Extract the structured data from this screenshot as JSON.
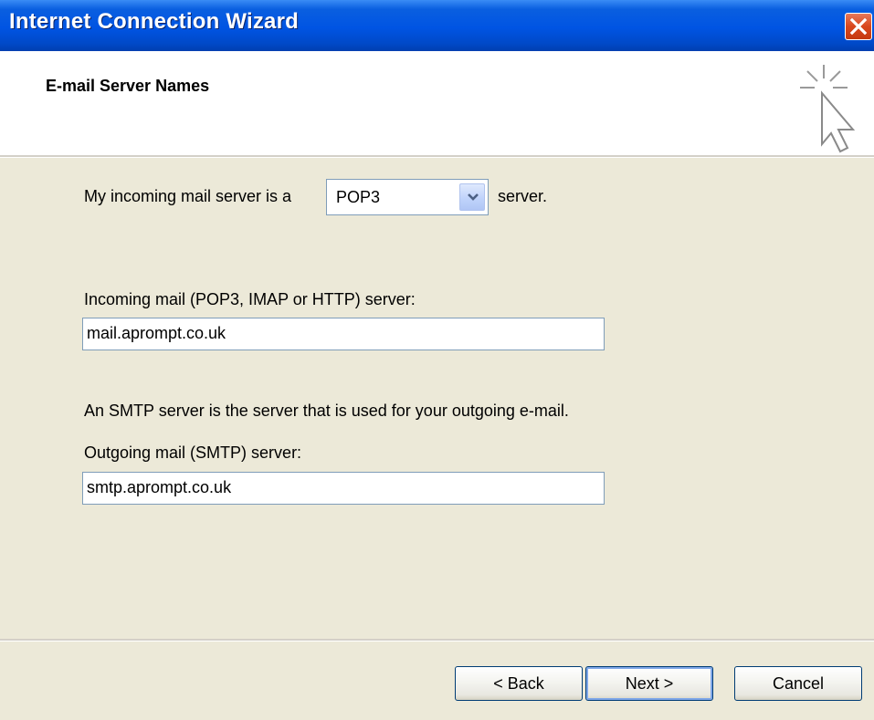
{
  "window": {
    "title": "Internet Connection Wizard",
    "close_icon": "close-icon"
  },
  "header": {
    "title": "E-mail Server Names",
    "icon": "wizard-cursor-icon"
  },
  "form": {
    "server_type_prefix": "My incoming mail server is a",
    "server_type_value": "POP3",
    "server_type_suffix": "server.",
    "incoming_label": "Incoming mail (POP3, IMAP or HTTP) server:",
    "incoming_value": "mail.aprompt.co.uk",
    "smtp_description": "An SMTP server is the server that is used for your outgoing e-mail.",
    "outgoing_label": "Outgoing mail (SMTP) server:",
    "outgoing_value": "smtp.aprompt.co.uk"
  },
  "buttons": {
    "back": "< Back",
    "next": "Next >",
    "cancel": "Cancel"
  },
  "colors": {
    "titlebar": "#0054e3",
    "close_button": "#d9471d",
    "dialog_background": "#ece9d8",
    "header_background": "#ffffff"
  }
}
